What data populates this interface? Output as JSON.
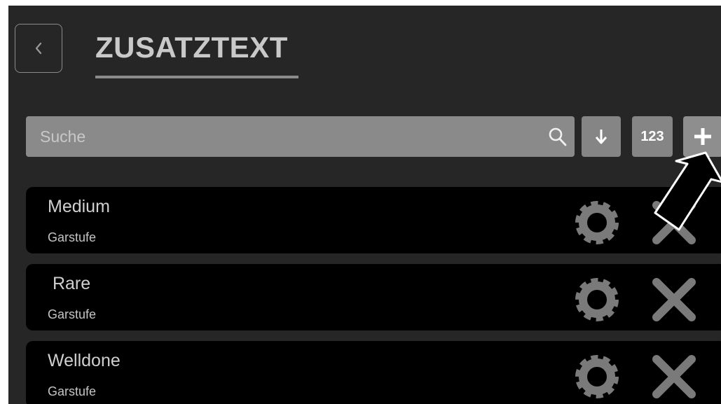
{
  "header": {
    "title": "ZUSATZTEXT"
  },
  "search": {
    "placeholder": "Suche"
  },
  "toolbar": {
    "number_label": "123"
  },
  "items": [
    {
      "title": "Medium",
      "category": "Garstufe"
    },
    {
      "title": " Rare",
      "category": "Garstufe"
    },
    {
      "title": "Welldone",
      "category": "Garstufe"
    }
  ],
  "icons": {
    "back": "chevron-left-icon",
    "search": "search-icon",
    "sort": "arrow-down-icon",
    "add": "plus-icon",
    "settings": "gear-icon",
    "delete": "close-icon",
    "annotation": "arrow-pointer-icon"
  },
  "colors": {
    "background": "#262626",
    "list_item": "#000000",
    "control": "#8a8a8a",
    "text": "#d0d0d0"
  }
}
